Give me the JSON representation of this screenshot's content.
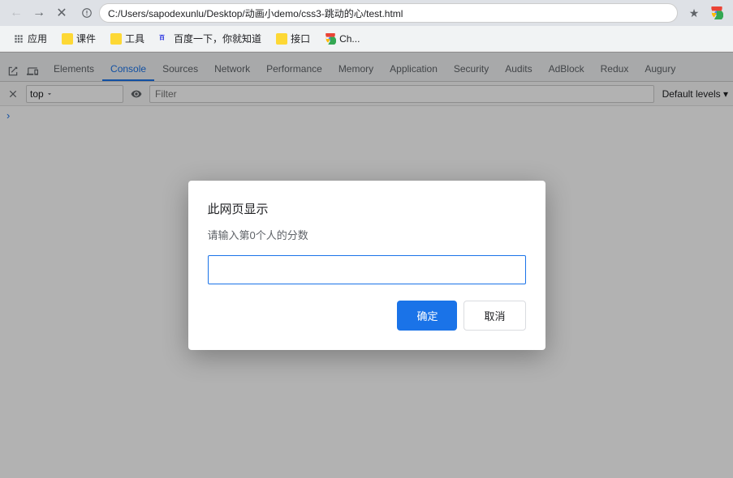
{
  "titleBar": {
    "url": "C:/Users/sapodexunlu/Desktop/动画小demo/css3-跳动的心/test.html",
    "back": "←",
    "forward": "→",
    "reload": "✕"
  },
  "bookmarks": {
    "items": [
      {
        "label": "应用",
        "icon": "grid"
      },
      {
        "label": "课件",
        "icon": "folder"
      },
      {
        "label": "工具",
        "icon": "folder"
      },
      {
        "label": "百度一下，你就知道",
        "icon": "baidu"
      },
      {
        "label": "接口",
        "icon": "folder"
      },
      {
        "label": "Ch...",
        "icon": "chrome"
      }
    ]
  },
  "modal": {
    "title": "此网页显示",
    "message": "请输入第0个人的分数",
    "input_placeholder": "",
    "confirm_label": "确定",
    "cancel_label": "取消"
  },
  "devtools": {
    "tabs": [
      {
        "label": "Elements",
        "active": false
      },
      {
        "label": "Console",
        "active": true
      },
      {
        "label": "Sources",
        "active": false
      },
      {
        "label": "Network",
        "active": false
      },
      {
        "label": "Performance",
        "active": false
      },
      {
        "label": "Memory",
        "active": false
      },
      {
        "label": "Application",
        "active": false
      },
      {
        "label": "Security",
        "active": false
      },
      {
        "label": "Audits",
        "active": false
      },
      {
        "label": "AdBlock",
        "active": false
      },
      {
        "label": "Redux",
        "active": false
      },
      {
        "label": "Augury",
        "active": false
      }
    ],
    "toolbar": {
      "context": "top",
      "filter_placeholder": "Filter",
      "default_levels": "Default levels ▾"
    }
  }
}
